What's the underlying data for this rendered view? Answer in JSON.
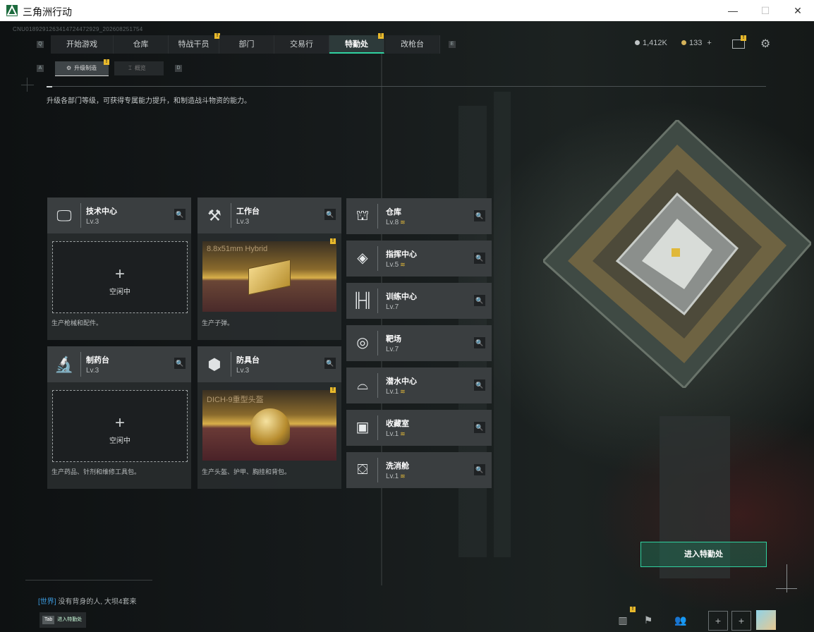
{
  "window": {
    "title": "三角洲行动",
    "minimize": "—",
    "maximize": "☐",
    "close": "✕"
  },
  "session_id": "CNU01892912634147244729​29_202608251754",
  "nav": {
    "left_key": "Q",
    "right_key": "E",
    "tabs": [
      {
        "label": "开始游戏"
      },
      {
        "label": "仓库"
      },
      {
        "label": "特战干员"
      },
      {
        "label": "部门"
      },
      {
        "label": "交易行"
      },
      {
        "label": "特勤处"
      },
      {
        "label": "改枪台"
      }
    ],
    "badge": "!"
  },
  "currency": {
    "hafcoin": "1,412K",
    "tickets": "133",
    "add": "+"
  },
  "subtabs": {
    "left_key": "A",
    "right_key": "D",
    "items": [
      {
        "label": "升级制造"
      },
      {
        "label": "概览"
      }
    ]
  },
  "description": "升级各部门等级，可获得专属能力提升，和制造战斗物资的能力。",
  "large_cards": [
    {
      "name": "技术中心",
      "level": "Lv.3",
      "slot_state": "空闲中",
      "plus": "+",
      "footer": "生产枪械和配件。",
      "icon": "monitor-icon"
    },
    {
      "name": "工作台",
      "level": "Lv.3",
      "product": "8.8x51mm Hybrid",
      "footer": "生产子弹。",
      "icon": "tools-icon"
    },
    {
      "name": "制药台",
      "level": "Lv.3",
      "slot_state": "空闲中",
      "plus": "+",
      "footer": "生产药品、针剂和维修工具包。",
      "icon": "microscope-icon"
    },
    {
      "name": "防具台",
      "level": "Lv.3",
      "product": "DICH-9重型头盔",
      "footer": "生产头盔、护甲、胸挂和背包。",
      "icon": "cubes-icon"
    }
  ],
  "small_cards": [
    {
      "name": "仓库",
      "level": "Lv.8",
      "upgradable": true,
      "icon": "warehouse-icon"
    },
    {
      "name": "指挥中心",
      "level": "Lv.5",
      "upgradable": true,
      "icon": "chip-icon"
    },
    {
      "name": "训练中心",
      "level": "Lv.7",
      "upgradable": false,
      "icon": "dumbbell-icon"
    },
    {
      "name": "靶场",
      "level": "Lv.7",
      "upgradable": false,
      "icon": "target-icon"
    },
    {
      "name": "潜水中心",
      "level": "Lv.1",
      "upgradable": true,
      "icon": "diving-icon"
    },
    {
      "name": "收藏室",
      "level": "Lv.1",
      "upgradable": true,
      "icon": "trophy-icon"
    },
    {
      "name": "洗消舱",
      "level": "Lv.1",
      "upgradable": true,
      "icon": "decon-icon"
    }
  ],
  "enter_button": "进入特勤处",
  "chat": {
    "channel": "[世界]",
    "message": "没有背身的人, 大坝4套来"
  },
  "tab_key": {
    "key": "Tab",
    "label": "进入特勤处"
  },
  "upgrade_mark": "≋",
  "search_icon": "🔍",
  "colors": {
    "accent": "#30d2a0",
    "badge": "#e8b92b",
    "upgrade": "#e0b83a",
    "chat_channel": "#3c9be0"
  }
}
